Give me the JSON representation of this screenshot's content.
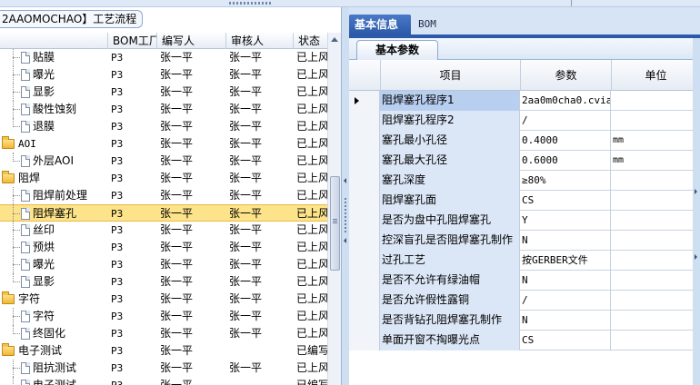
{
  "left_panel": {
    "title": "2AAOMOCHAO】工艺流程",
    "columns": [
      "BOM工厂",
      "编写人",
      "审核人",
      "状态"
    ],
    "rows": [
      {
        "indent": 1,
        "type": "doc",
        "name": "贴膜",
        "bom": "P3",
        "writer": "张一平",
        "reviewer": "张一平",
        "status": "已上风"
      },
      {
        "indent": 1,
        "type": "doc",
        "name": "曝光",
        "bom": "P3",
        "writer": "张一平",
        "reviewer": "张一平",
        "status": "已上风"
      },
      {
        "indent": 1,
        "type": "doc",
        "name": "显影",
        "bom": "P3",
        "writer": "张一平",
        "reviewer": "张一平",
        "status": "已上风"
      },
      {
        "indent": 1,
        "type": "doc",
        "name": "酸性蚀刻",
        "bom": "P3",
        "writer": "张一平",
        "reviewer": "张一平",
        "status": "已上风"
      },
      {
        "indent": 1,
        "type": "doc",
        "name": "退膜",
        "bom": "P3",
        "writer": "张一平",
        "reviewer": "张一平",
        "status": "已上风"
      },
      {
        "indent": 0,
        "type": "folder",
        "name": "AOI",
        "bom": "P3",
        "writer": "张一平",
        "reviewer": "张一平",
        "status": "已上风"
      },
      {
        "indent": 1,
        "type": "doc",
        "name": "外层AOI",
        "bom": "P3",
        "writer": "张一平",
        "reviewer": "张一平",
        "status": "已上风"
      },
      {
        "indent": 0,
        "type": "folder",
        "name": "阻焊",
        "bom": "P3",
        "writer": "张一平",
        "reviewer": "张一平",
        "status": "已上风"
      },
      {
        "indent": 1,
        "type": "doc",
        "name": "阻焊前处理",
        "bom": "P3",
        "writer": "张一平",
        "reviewer": "张一平",
        "status": "已上风"
      },
      {
        "indent": 1,
        "type": "doc",
        "name": "阻焊塞孔",
        "bom": "P3",
        "writer": "张一平",
        "reviewer": "张一平",
        "status": "已上风",
        "selected": true
      },
      {
        "indent": 1,
        "type": "doc",
        "name": "丝印",
        "bom": "P3",
        "writer": "张一平",
        "reviewer": "张一平",
        "status": "已上风"
      },
      {
        "indent": 1,
        "type": "doc",
        "name": "预烘",
        "bom": "P3",
        "writer": "张一平",
        "reviewer": "张一平",
        "status": "已上风"
      },
      {
        "indent": 1,
        "type": "doc",
        "name": "曝光",
        "bom": "P3",
        "writer": "张一平",
        "reviewer": "张一平",
        "status": "已上风"
      },
      {
        "indent": 1,
        "type": "doc",
        "name": "显影",
        "bom": "P3",
        "writer": "张一平",
        "reviewer": "张一平",
        "status": "已上风"
      },
      {
        "indent": 0,
        "type": "folder",
        "name": "字符",
        "bom": "P3",
        "writer": "张一平",
        "reviewer": "张一平",
        "status": "已上风"
      },
      {
        "indent": 1,
        "type": "doc",
        "name": "字符",
        "bom": "P3",
        "writer": "张一平",
        "reviewer": "张一平",
        "status": "已上风"
      },
      {
        "indent": 1,
        "type": "doc",
        "name": "终固化",
        "bom": "P3",
        "writer": "张一平",
        "reviewer": "张一平",
        "status": "已上风"
      },
      {
        "indent": 0,
        "type": "folder",
        "name": "电子测试",
        "bom": "P3",
        "writer": "张一平",
        "reviewer": "",
        "status": "已编写"
      },
      {
        "indent": 1,
        "type": "doc",
        "name": "阻抗测试",
        "bom": "P3",
        "writer": "张一平",
        "reviewer": "张一平",
        "status": "已上风"
      },
      {
        "indent": 1,
        "type": "doc",
        "name": "电子测试",
        "bom": "P3",
        "writer": "张一平",
        "reviewer": "",
        "status": "已编写"
      }
    ]
  },
  "right_panel": {
    "tabs": [
      "基本信息",
      "BOM"
    ],
    "active_tab": "基本信息",
    "sub_tab": "基本参数",
    "columns": [
      "项目",
      "参数",
      "单位"
    ],
    "rows": [
      {
        "item": "阻焊塞孔程序1",
        "param": "2aa0m0cha0.cvia",
        "unit": "",
        "current": true
      },
      {
        "item": "阻焊塞孔程序2",
        "param": "/",
        "unit": ""
      },
      {
        "item": "塞孔最小孔径",
        "param": "0.4000",
        "unit": "mm"
      },
      {
        "item": "塞孔最大孔径",
        "param": "0.6000",
        "unit": "mm"
      },
      {
        "item": "塞孔深度",
        "param": "≥80%",
        "unit": ""
      },
      {
        "item": "阻焊塞孔面",
        "param": "CS",
        "unit": ""
      },
      {
        "item": "是否为盘中孔阻焊塞孔",
        "param": "Y",
        "unit": ""
      },
      {
        "item": "控深盲孔是否阻焊塞孔制作",
        "param": "N",
        "unit": ""
      },
      {
        "item": "过孔工艺",
        "param": "按GERBER文件",
        "unit": ""
      },
      {
        "item": "是否不允许有绿油帽",
        "param": "N",
        "unit": ""
      },
      {
        "item": "是否允许假性露铜",
        "param": "/",
        "unit": ""
      },
      {
        "item": "是否背钻孔阻焊塞孔制作",
        "param": "N",
        "unit": ""
      },
      {
        "item": "单面开窗不掏曝光点",
        "param": "CS",
        "unit": ""
      }
    ]
  },
  "colors": {
    "tab_active": "#2d5aa8",
    "selected_row": "#fde38a",
    "item_cell": "#dbe6f6"
  }
}
